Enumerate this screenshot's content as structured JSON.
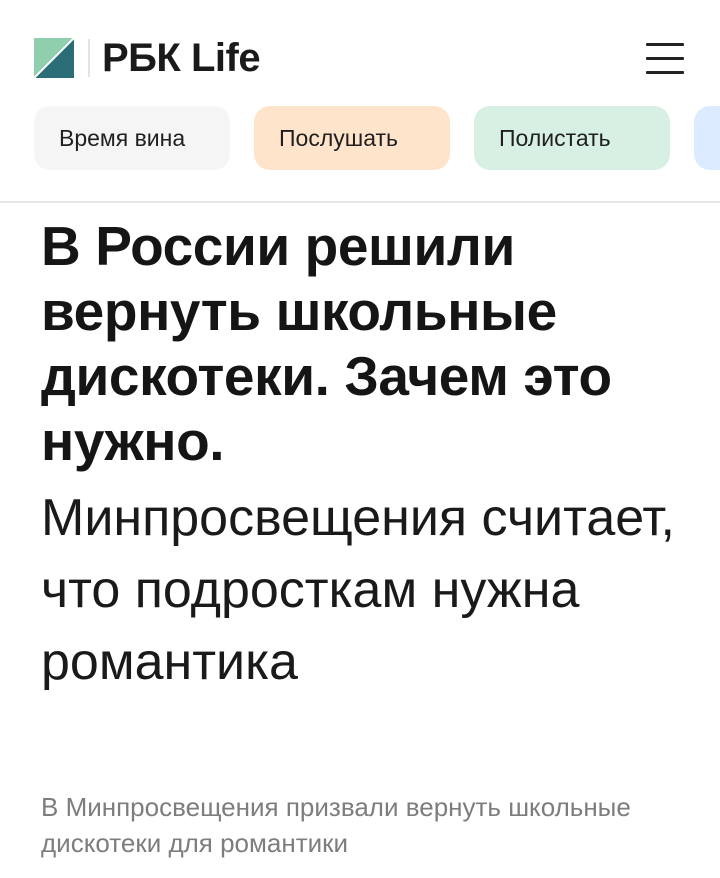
{
  "header": {
    "logo_text": "РБК Life",
    "logo_colors": {
      "dark": "#2a6d77",
      "light": "#8fcfae"
    },
    "menu_icon": "hamburger-menu-icon"
  },
  "categories": [
    {
      "label": "Время вина",
      "color": "#f5f5f5"
    },
    {
      "label": "Послушать",
      "color": "#ffe4cc"
    },
    {
      "label": "Полистать",
      "color": "#d8f0e4"
    },
    {
      "label": "",
      "color": "#dcebff"
    }
  ],
  "article": {
    "title": "В России решили вернуть школьные дискотеки. Зачем это нужно.",
    "subtitle": "Минпросвещения считает, что подросткам нужна романтика",
    "lede": "В Минпросвещения призвали вернуть школьные дискотеки для романтики"
  }
}
